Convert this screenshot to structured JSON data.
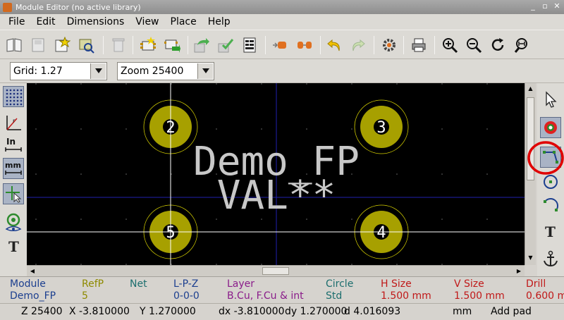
{
  "window": {
    "title": "Module Editor (no active library)"
  },
  "menu": [
    "File",
    "Edit",
    "Dimensions",
    "View",
    "Place",
    "Help"
  ],
  "toolbar": {
    "grid_value": "Grid: 1.27",
    "zoom_value": "Zoom 25400"
  },
  "footprint": {
    "reference": "Demo_FP",
    "value": "VAL**",
    "pads": [
      {
        "number": "2"
      },
      {
        "number": "3"
      },
      {
        "number": "5"
      },
      {
        "number": "4"
      }
    ]
  },
  "message_panel": {
    "columns": [
      {
        "header": "Module",
        "value": "Demo_FP",
        "header_color": "#1c3f8f",
        "value_color": "#1c3f8f"
      },
      {
        "header": "RefP",
        "value": "5",
        "header_color": "#8e8a00",
        "value_color": "#8e8a00"
      },
      {
        "header": "Net",
        "value": "",
        "header_color": "#1c6e6e",
        "value_color": "#1c6e6e"
      },
      {
        "header": "L-P-Z",
        "value": "0-0-0",
        "header_color": "#1c3f8f",
        "value_color": "#1c3f8f"
      },
      {
        "header": "Layer",
        "value": "B.Cu, F.Cu & int",
        "header_color": "#8a1c8a",
        "value_color": "#8a1c8a"
      },
      {
        "header": "Circle",
        "value": "Std",
        "header_color": "#1c6e6e",
        "value_color": "#1c6e6e"
      },
      {
        "header": "H Size",
        "value": "1.500 mm",
        "header_color": "#c01818",
        "value_color": "#c01818"
      },
      {
        "header": "V Size",
        "value": "1.500 mm",
        "header_color": "#c01818",
        "value_color": "#c01818"
      },
      {
        "header": "Drill",
        "value": "0.600 m",
        "header_color": "#c01818",
        "value_color": "#c01818"
      }
    ]
  },
  "status": {
    "zoom": "Z 25400",
    "x": "X -3.810000",
    "y": "Y 1.270000",
    "dx": "dx -3.810000",
    "dy": "dy 1.270000",
    "d": "d 4.016093",
    "units": "mm",
    "mode": "Add pad"
  },
  "colors": {
    "pad_copper": "#a7a000",
    "pad_ring": "#d6d000",
    "text_gray": "#c8c8c8",
    "axis_blue": "#1f1faf",
    "highlight_red": "#e00000"
  }
}
